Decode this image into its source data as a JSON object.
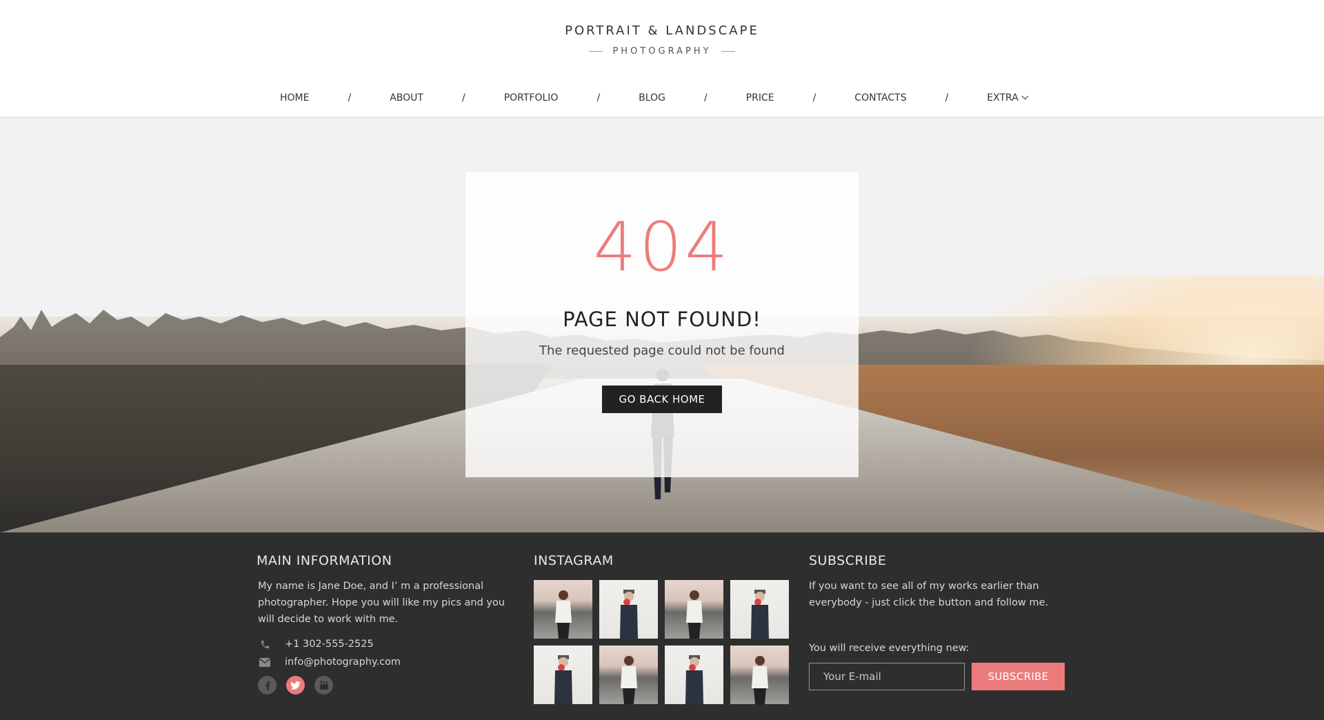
{
  "brand": {
    "title": "PORTRAIT & LANDSCAPE",
    "subtitle": "PHOTOGRAPHY"
  },
  "nav": {
    "items": [
      "HOME",
      "ABOUT",
      "PORTFOLIO",
      "BLOG",
      "PRICE",
      "CONTACTS",
      "EXTRA"
    ],
    "separator": "/"
  },
  "error": {
    "code": "404",
    "title": "PAGE NOT FOUND!",
    "message": "The requested page could not be found",
    "button": "GO BACK HOME"
  },
  "footer": {
    "main": {
      "title": "MAIN INFORMATION",
      "about": "My name is Jane Doe, and I’ m a professional photographer. Hope you will like my pics and you will decide to work with me.",
      "phone": "+1 302-555-2525",
      "email": "info@photography.com",
      "socials": [
        "facebook-icon",
        "twitter-icon",
        "youtube-icon"
      ]
    },
    "instagram": {
      "title": "INSTAGRAM"
    },
    "subscribe": {
      "title": "SUBSCRIBE",
      "text": "If you want to see all of my works earlier than everybody - just click the button and follow me.",
      "note": "You will receive everything new:",
      "placeholder": "Your E-mail",
      "button": "SUBSCRIBE"
    }
  },
  "colors": {
    "accent": "#ec7c7c",
    "footer_bg": "#2e2e2e",
    "button_dark": "#222222"
  }
}
